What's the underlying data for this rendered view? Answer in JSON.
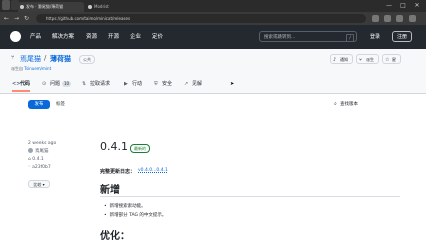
{
  "browser": {
    "tab_title": "发布 · 灏尾猫/薄荷猫",
    "tab2_title": "Modrist",
    "url": "https://github.com/taimo/minicat/releases",
    "window_controls": [
      "—",
      "□",
      "✕"
    ]
  },
  "gh_header": {
    "nav": [
      "产品",
      "解决方案",
      "资源",
      "开源",
      "企业",
      "定价"
    ],
    "search_placeholder": "搜索或跳转到...",
    "slash": "/",
    "signin": "登录",
    "signup": "注册"
  },
  "repo": {
    "owner": "焉尾猫",
    "sep": "/",
    "name": "薄荷猫",
    "visibility": "公共",
    "fork_prefix": "派生自",
    "fork_link": "Tsinuem/mint",
    "notify": "通知",
    "fork": "派生",
    "star": "星"
  },
  "repo_tabs": [
    {
      "icon": "<>",
      "label": "代码",
      "count": ""
    },
    {
      "icon": "⊙",
      "label": "问题",
      "count": "10"
    },
    {
      "icon": "⇅",
      "label": "拉取请求",
      "count": ""
    },
    {
      "icon": "▶",
      "label": "行动",
      "count": ""
    },
    {
      "icon": "⛨",
      "label": "安全",
      "count": ""
    },
    {
      "icon": "↗",
      "label": "见解",
      "count": ""
    }
  ],
  "subtabs": {
    "releases": "发布",
    "tags": "标签",
    "find": "查找版本"
  },
  "release": {
    "time": "2 weeks ago",
    "author": "焉尾猫",
    "tag": "0.4.1",
    "commit": "a23f0b7",
    "compare": "比较",
    "version": "0.4.1",
    "latest": "最新的",
    "full_changes_label": "完整更新日志：",
    "compare_link": "v0.4.0...0.4.1",
    "h_new": "新增",
    "new_items": [
      "新增搜索索动能。",
      "新增部分 TAG 的中文提示。"
    ],
    "h_opt": "优化："
  }
}
